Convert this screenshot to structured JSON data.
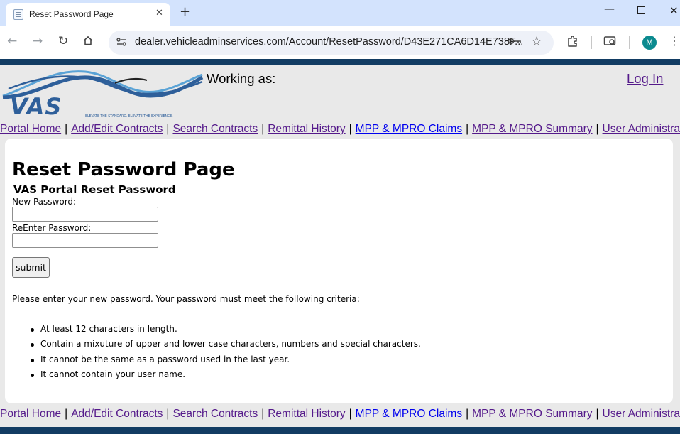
{
  "browser": {
    "tab_title": "Reset Password Page",
    "tab_close": "✕",
    "new_tab": "+",
    "url": "dealer.vehicleadminservices.com/Account/ResetPassword/D43E271CA6D14E738F...",
    "profile_initial": "M"
  },
  "header": {
    "logo_text": "VAS",
    "logo_tagline": "ELEVATE THE STANDARD. ELEVATE THE EXPERIENCE.",
    "working_as_label": "Working as:",
    "login_link": "Log In"
  },
  "nav": {
    "items": [
      {
        "label": "Portal Home",
        "visited": true
      },
      {
        "label": "Add/Edit Contracts",
        "visited": true
      },
      {
        "label": "Search Contracts",
        "visited": true
      },
      {
        "label": "Remittal History",
        "visited": true
      },
      {
        "label": "MPP & MPRO Claims",
        "visited": false
      },
      {
        "label": "MPP & MPRO Summary",
        "visited": true
      },
      {
        "label": "User Administration",
        "visited": true
      }
    ],
    "separator": "|"
  },
  "main": {
    "title": "Reset Password Page",
    "subtitle": "VAS Portal Reset Password",
    "new_password_label": "New Password:",
    "new_password_value": "",
    "reenter_password_label": "ReEnter Password:",
    "reenter_password_value": "",
    "submit_label": "submit",
    "instructions": "Please enter your new password. Your password must meet the following criteria:",
    "criteria": [
      "At least 12 characters in length.",
      "Contain a mixuture of upper and lower case characters, numbers and special characters.",
      "It cannot be the same as a password used in the last year.",
      "It cannot contain your user name."
    ]
  },
  "colors": {
    "brand_navy": "#123c63",
    "logo_blue": "#2e5f9a",
    "logo_light_blue": "#5aa3d6",
    "visited_link": "#551a8b",
    "unvisited_link": "#0000ee",
    "page_background": "#e9e9e9"
  }
}
